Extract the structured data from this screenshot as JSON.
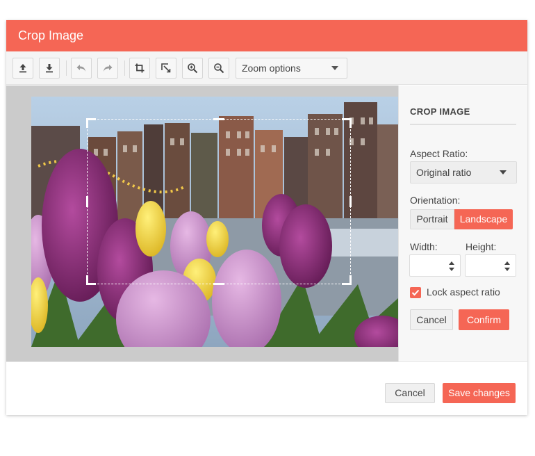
{
  "dialog": {
    "title": "Crop Image"
  },
  "toolbar": {
    "buttons": [
      {
        "name": "upload-button",
        "icon": "upload-icon"
      },
      {
        "name": "download-button",
        "icon": "download-icon"
      },
      {
        "name": "undo-button",
        "icon": "undo-icon"
      },
      {
        "name": "redo-button",
        "icon": "redo-icon"
      },
      {
        "name": "crop-button",
        "icon": "crop-icon"
      },
      {
        "name": "fit-button",
        "icon": "fit-icon"
      },
      {
        "name": "zoom-in-button",
        "icon": "zoom-in-icon"
      },
      {
        "name": "zoom-out-button",
        "icon": "zoom-out-icon"
      }
    ],
    "zoom_select": {
      "value": "Zoom options"
    }
  },
  "panel": {
    "title": "CROP IMAGE",
    "aspect_label": "Aspect Ratio:",
    "aspect_value": "Original ratio",
    "orientation_label": "Orientation:",
    "orientation_options": [
      "Portrait",
      "Landscape"
    ],
    "orientation_selected": "Landscape",
    "width_label": "Width:",
    "width_value": "",
    "height_label": "Height:",
    "height_value": "",
    "lock_label": "Lock aspect ratio",
    "lock_checked": true,
    "cancel_label": "Cancel",
    "confirm_label": "Confirm"
  },
  "footer": {
    "cancel_label": "Cancel",
    "save_label": "Save changes"
  },
  "colors": {
    "accent": "#f56655",
    "canvas_bg": "#cbcbcb",
    "panel_bg": "#f7f7f7"
  }
}
